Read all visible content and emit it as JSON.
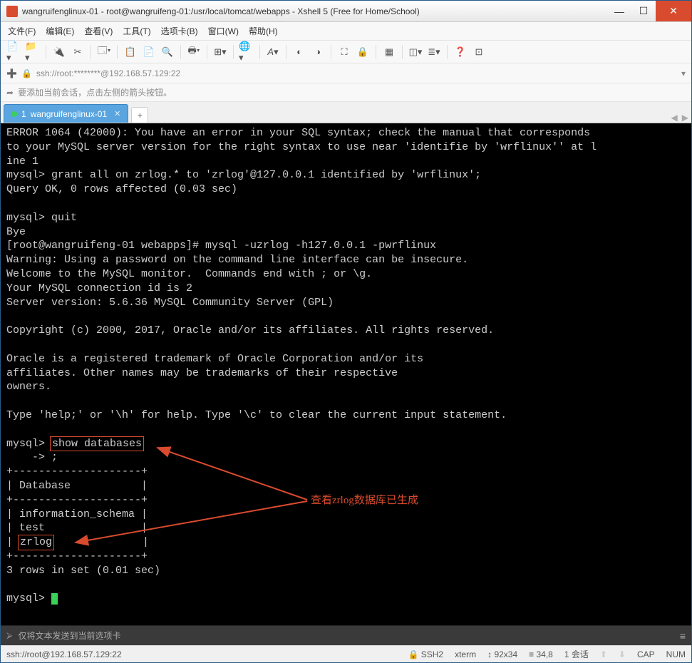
{
  "window": {
    "title": "wangruifenglinux-01 - root@wangruifeng-01:/usr/local/tomcat/webapps - Xshell 5 (Free for Home/School)"
  },
  "menu": {
    "file": "文件(F)",
    "edit": "编辑(E)",
    "view": "查看(V)",
    "tools": "工具(T)",
    "tab": "选项卡(B)",
    "window": "窗口(W)",
    "help": "帮助(H)"
  },
  "addressbar": {
    "lock": "🔒",
    "url": "ssh://root:********@192.168.57.129:22"
  },
  "hint": {
    "icon": "➦",
    "text": "要添加当前会话，点击左侧的箭头按钮。"
  },
  "tab": {
    "index": "1",
    "label": "wangruifenglinux-01"
  },
  "tabbar_nav": {
    "prev": "◀",
    "next": "▶"
  },
  "terminal": {
    "lines": [
      "ERROR 1064 (42000): You have an error in your SQL syntax; check the manual that corresponds",
      "to your MySQL server version for the right syntax to use near 'identifie by 'wrflinux'' at l",
      "ine 1",
      "mysql> grant all on zrlog.* to 'zrlog'@127.0.0.1 identified by 'wrflinux';",
      "Query OK, 0 rows affected (0.03 sec)",
      "",
      "mysql> quit",
      "Bye",
      "[root@wangruifeng-01 webapps]# mysql -uzrlog -h127.0.0.1 -pwrflinux",
      "Warning: Using a password on the command line interface can be insecure.",
      "Welcome to the MySQL monitor.  Commands end with ; or \\g.",
      "Your MySQL connection id is 2",
      "Server version: 5.6.36 MySQL Community Server (GPL)",
      "",
      "Copyright (c) 2000, 2017, Oracle and/or its affiliates. All rights reserved.",
      "",
      "Oracle is a registered trademark of Oracle Corporation and/or its",
      "affiliates. Other names may be trademarks of their respective",
      "owners.",
      "",
      "Type 'help;' or '\\h' for help. Type '\\c' to clear the current input statement.",
      "",
      "mysql> ",
      "    -> ;",
      "+--------------------+",
      "| Database           |",
      "+--------------------+",
      "| information_schema |",
      "| test               |",
      "| ",
      "+--------------------+",
      "3 rows in set (0.01 sec)",
      "",
      "mysql> "
    ],
    "highlight_cmd": "show databases",
    "highlight_db": "zrlog",
    "db_row_suffix": "              |",
    "annotation": "查看zrlog数据库已生成"
  },
  "footer": {
    "send_hint": "仅将文本发送到当前选项卡"
  },
  "status": {
    "conn": "ssh://root@192.168.57.129:22",
    "proto": "SSH2",
    "term": "xterm",
    "size": "92x34",
    "cursor_pos": "34,8",
    "sessions": "1 会话",
    "caps": "CAP",
    "num": "NUM"
  }
}
